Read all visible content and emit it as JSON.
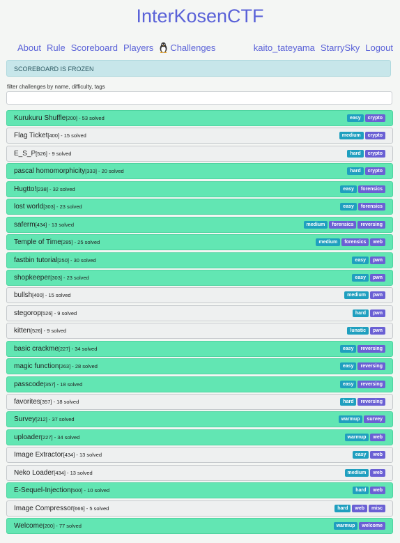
{
  "brand": "InterKosenCTF",
  "nav": {
    "left": [
      "About",
      "Rule",
      "Scoreboard",
      "Players"
    ],
    "challenges": "Challenges",
    "right": [
      "kaito_tateyama",
      "StarrySky",
      "Logout"
    ]
  },
  "alert": "SCOREBOARD IS FROZEN",
  "filter": {
    "label": "filter challenges by name, difficulty, tags",
    "placeholder": "",
    "value": ""
  },
  "challenges": [
    {
      "name": "Kurukuru Shuffle",
      "score": "[200]",
      "solves": " - 53 solved",
      "solved": true,
      "tags": [
        "easy",
        "crypto"
      ]
    },
    {
      "name": "Flag Ticket",
      "score": "[400]",
      "solves": " - 15 solved",
      "solved": false,
      "tags": [
        "medium",
        "crypto"
      ]
    },
    {
      "name": "E_S_P",
      "score": "[526]",
      "solves": " - 9 solved",
      "solved": false,
      "tags": [
        "hard",
        "crypto"
      ]
    },
    {
      "name": "pascal homomorphicity",
      "score": "[333]",
      "solves": " - 20 solved",
      "solved": true,
      "tags": [
        "hard",
        "crypto"
      ]
    },
    {
      "name": "Hugtto!",
      "score": "[238]",
      "solves": " - 32 solved",
      "solved": true,
      "tags": [
        "easy",
        "forensics"
      ]
    },
    {
      "name": "lost world",
      "score": "[303]",
      "solves": " - 23 solved",
      "solved": true,
      "tags": [
        "easy",
        "forensics"
      ]
    },
    {
      "name": "saferm",
      "score": "[434]",
      "solves": " - 13 solved",
      "solved": true,
      "tags": [
        "medium",
        "forensics",
        "reversing"
      ]
    },
    {
      "name": "Temple of Time",
      "score": "[285]",
      "solves": " - 25 solved",
      "solved": true,
      "tags": [
        "medium",
        "forensics",
        "web"
      ]
    },
    {
      "name": "fastbin tutorial",
      "score": "[250]",
      "solves": " - 30 solved",
      "solved": true,
      "tags": [
        "easy",
        "pwn"
      ]
    },
    {
      "name": "shopkeeper",
      "score": "[303]",
      "solves": " - 23 solved",
      "solved": true,
      "tags": [
        "easy",
        "pwn"
      ]
    },
    {
      "name": "bullsh",
      "score": "[400]",
      "solves": " - 15 solved",
      "solved": false,
      "tags": [
        "medium",
        "pwn"
      ]
    },
    {
      "name": "stegorop",
      "score": "[526]",
      "solves": " - 9 solved",
      "solved": false,
      "tags": [
        "hard",
        "pwn"
      ]
    },
    {
      "name": "kitten",
      "score": "[526]",
      "solves": " - 9 solved",
      "solved": false,
      "tags": [
        "lunatic",
        "pwn"
      ]
    },
    {
      "name": "basic crackme",
      "score": "[227]",
      "solves": " - 34 solved",
      "solved": true,
      "tags": [
        "easy",
        "reversing"
      ]
    },
    {
      "name": "magic function",
      "score": "[263]",
      "solves": " - 28 solved",
      "solved": true,
      "tags": [
        "easy",
        "reversing"
      ]
    },
    {
      "name": "passcode",
      "score": "[357]",
      "solves": " - 18 solved",
      "solved": true,
      "tags": [
        "easy",
        "reversing"
      ]
    },
    {
      "name": "favorites",
      "score": "[357]",
      "solves": " - 18 solved",
      "solved": false,
      "tags": [
        "hard",
        "reversing"
      ]
    },
    {
      "name": "Survey",
      "score": "[212]",
      "solves": " - 37 solved",
      "solved": true,
      "tags": [
        "warmup",
        "survey"
      ]
    },
    {
      "name": "uploader",
      "score": "[227]",
      "solves": " - 34 solved",
      "solved": true,
      "tags": [
        "warmup",
        "web"
      ]
    },
    {
      "name": "Image Extractor",
      "score": "[434]",
      "solves": " - 13 solved",
      "solved": false,
      "tags": [
        "easy",
        "web"
      ]
    },
    {
      "name": "Neko Loader",
      "score": "[434]",
      "solves": " - 13 solved",
      "solved": false,
      "tags": [
        "medium",
        "web"
      ]
    },
    {
      "name": "E-Sequel-Injection",
      "score": "[500]",
      "solves": " - 10 solved",
      "solved": true,
      "tags": [
        "hard",
        "web"
      ]
    },
    {
      "name": "Image Compressor",
      "score": "[666]",
      "solves": " - 5 solved",
      "solved": false,
      "tags": [
        "hard",
        "web",
        "misc"
      ]
    },
    {
      "name": "Welcome",
      "score": "[200]",
      "solves": " - 77 solved",
      "solved": true,
      "tags": [
        "warmup",
        "welcome"
      ]
    }
  ],
  "difficulty_tags": [
    "warmup",
    "easy",
    "medium",
    "hard",
    "lunatic"
  ],
  "colors": {
    "brand": "#5a62d8",
    "solved_row": "#62e6b3",
    "unsolved_row": "#eef0f0",
    "difficulty_tag": "#1f9fbf",
    "category_tag": "#6a60d4",
    "alert_bg": "#c7e6ea"
  }
}
